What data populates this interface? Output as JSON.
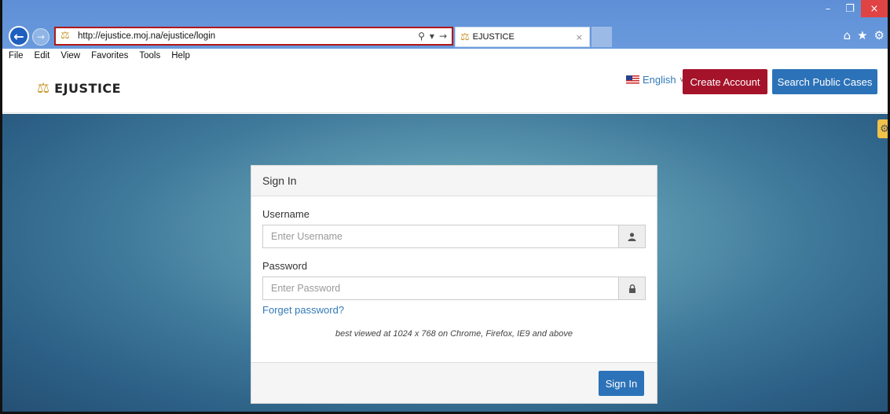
{
  "browser": {
    "url": "http://ejustice.moj.na/ejustice/login",
    "tab_title": "EJUSTICE",
    "tab_close": "×",
    "window_controls": {
      "minimize": "–",
      "restore": "❐",
      "close": "×"
    },
    "menu": [
      "File",
      "Edit",
      "View",
      "Favorites",
      "Tools",
      "Help"
    ],
    "icons": {
      "back": "arrow-left-icon",
      "forward": "arrow-right-icon",
      "search": "search-icon",
      "go": "go-arrow-icon",
      "home": "home-icon",
      "favorites": "star-icon",
      "settings": "gear-icon"
    }
  },
  "header": {
    "logo_text": "EJUSTICE",
    "language": "English",
    "create_account": "Create Account",
    "search_public_cases": "Search Public Cases"
  },
  "signin": {
    "title": "Sign In",
    "username_label": "Username",
    "username_placeholder": "Enter Username",
    "password_label": "Password",
    "password_placeholder": "Enter Password",
    "forgot": "Forget password?",
    "note": "best viewed at 1024 x 768 on Chrome, Firefox, IE9 and above",
    "submit": "Sign In"
  },
  "colors": {
    "create_button": "#a5132a",
    "primary_button": "#2c72b8",
    "link": "#337ab7",
    "browser_chrome": "#6495d8"
  }
}
